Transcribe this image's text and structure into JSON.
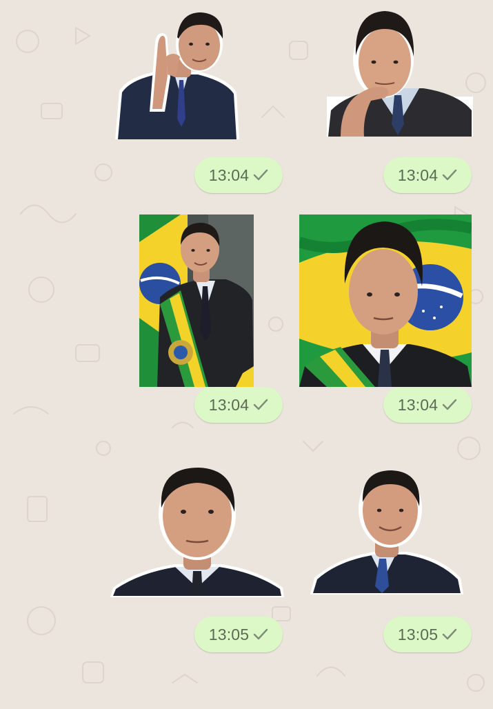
{
  "chat": {
    "messages": [
      {
        "id": "m1",
        "type": "sticker",
        "subject": "man in suit waving with raised hand",
        "timestamp": "13:04",
        "status": "sent-check"
      },
      {
        "id": "m2",
        "type": "sticker",
        "subject": "man in suit, hand on chin, thinking",
        "timestamp": "13:04",
        "status": "sent-check"
      },
      {
        "id": "m3",
        "type": "sticker",
        "subject": "man with presidential sash in front of Brazil flag",
        "timestamp": "13:04",
        "status": "sent-check"
      },
      {
        "id": "m4",
        "type": "sticker",
        "subject": "man in suit in front of waving Brazil flag",
        "timestamp": "13:04",
        "status": "sent-check"
      },
      {
        "id": "m5",
        "type": "sticker",
        "subject": "man in suit looking upward",
        "timestamp": "13:05",
        "status": "sent-check"
      },
      {
        "id": "m6",
        "type": "sticker",
        "subject": "man in suit smiling",
        "timestamp": "13:05",
        "status": "sent-check"
      }
    ]
  },
  "colors": {
    "wallpaper": "#ece5dd",
    "outgoing_bubble": "#dcf8c6",
    "timestamp_text": "#5b6b55",
    "tick": "#7d8a77"
  },
  "icons": {
    "tick": "check-icon"
  }
}
